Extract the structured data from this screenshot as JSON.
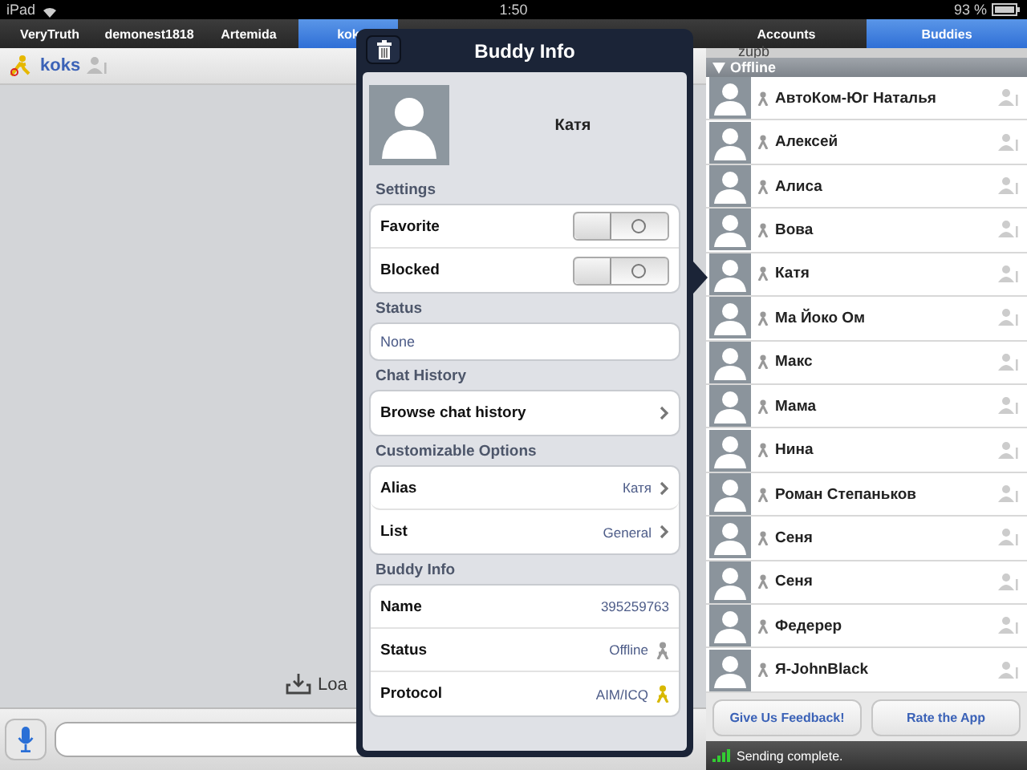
{
  "status_bar": {
    "device": "iPad",
    "time": "1:50",
    "battery": "93 %"
  },
  "conversation_tabs": [
    {
      "label": "VeryTruth",
      "selected": false
    },
    {
      "label": "demonest1818",
      "selected": false
    },
    {
      "label": "Artemida",
      "selected": false
    },
    {
      "label": "kok",
      "selected": true
    }
  ],
  "chat": {
    "buddy": "koks",
    "load_label": "Loa"
  },
  "buddy_info": {
    "title": "Buddy Info",
    "name": "Катя",
    "sections": [
      {
        "title": "Settings",
        "rows": [
          {
            "kind": "toggle",
            "label": "Favorite",
            "on": false
          },
          {
            "kind": "toggle",
            "label": "Blocked",
            "on": false
          }
        ]
      },
      {
        "title": "Status",
        "rows": [
          {
            "kind": "field",
            "value": "None"
          }
        ]
      },
      {
        "title": "Chat History",
        "rows": [
          {
            "kind": "link",
            "label": "Browse chat history"
          }
        ]
      },
      {
        "title": "Customizable Options",
        "rows": [
          {
            "kind": "link",
            "label": "Alias",
            "value": "Катя"
          },
          {
            "kind": "link",
            "label": "List",
            "value": "General"
          }
        ]
      },
      {
        "title": "Buddy Info",
        "rows": [
          {
            "kind": "info",
            "label": "Name",
            "value": "395259763"
          },
          {
            "kind": "info",
            "label": "Status",
            "value": "Offline",
            "online": false
          },
          {
            "kind": "info",
            "label": "Protocol",
            "value": "AIM/ICQ",
            "online": true
          }
        ]
      }
    ]
  },
  "panel_tabs": [
    {
      "label": "Accounts",
      "selected": false
    },
    {
      "label": "Buddies",
      "selected": true
    }
  ],
  "buddies": {
    "partial_row": "zupb",
    "group": {
      "label": "Offline",
      "expanded": true
    },
    "items": [
      "АвтоКом-Юг Наталья",
      "Алексей",
      "Алиса",
      "Вова",
      "Катя",
      "Ма Йоко Ом",
      "Макс",
      "Мама",
      "Нина",
      "Роман Степаньков",
      "Сеня",
      "Сеня",
      "Федерер",
      "Я-JohnBlack"
    ]
  },
  "buttons": [
    "Give Us Feedback!",
    "Rate the App"
  ],
  "footer_status": "Sending complete."
}
